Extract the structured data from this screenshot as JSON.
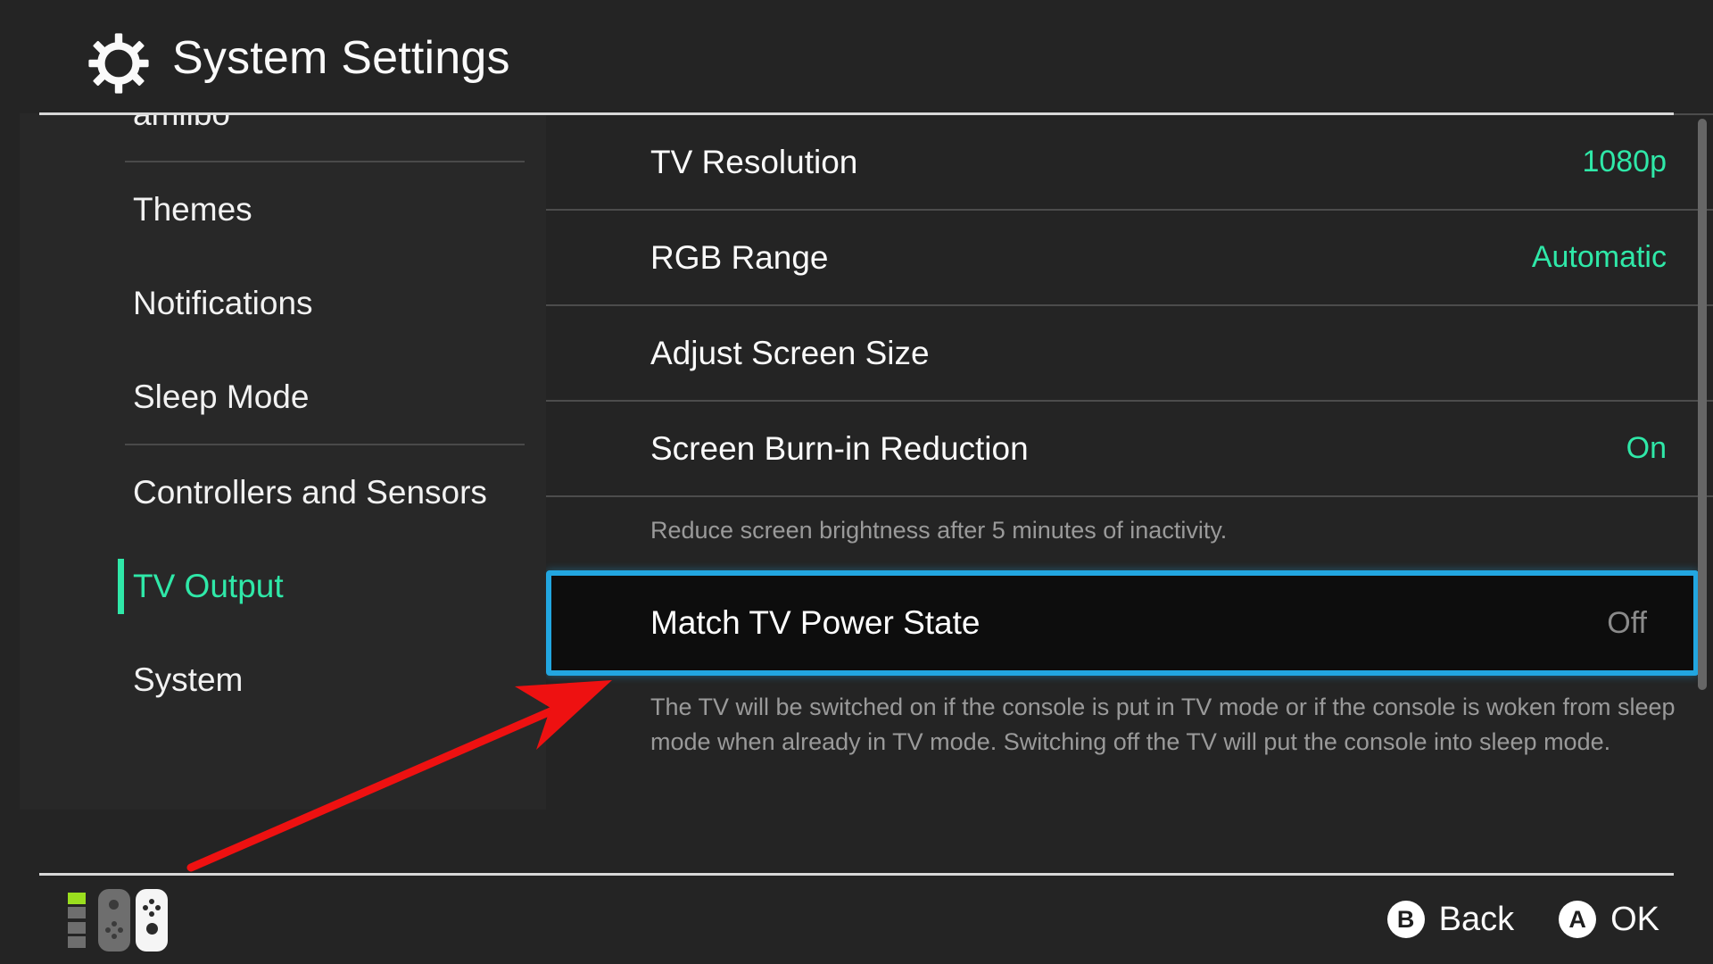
{
  "header": {
    "title": "System Settings",
    "icon": "gear-icon"
  },
  "sidebar": {
    "clipped_top_item": "amiibo",
    "items": [
      {
        "label": "Themes",
        "selected": false
      },
      {
        "label": "Notifications",
        "selected": false
      },
      {
        "label": "Sleep Mode",
        "selected": false
      },
      {
        "label": "Controllers and Sensors",
        "selected": false
      },
      {
        "label": "TV Output",
        "selected": true
      },
      {
        "label": "System",
        "selected": false
      }
    ]
  },
  "panel": {
    "rows": [
      {
        "label": "TV Resolution",
        "value": "1080p",
        "value_state": "accent"
      },
      {
        "label": "RGB Range",
        "value": "Automatic",
        "value_state": "accent"
      },
      {
        "label": "Adjust Screen Size",
        "value": "",
        "value_state": "none"
      },
      {
        "label": "Screen Burn-in Reduction",
        "value": "On",
        "value_state": "accent"
      }
    ],
    "burn_in_note": "Reduce screen brightness after 5 minutes of inactivity.",
    "focused_row": {
      "label": "Match TV Power State",
      "value": "Off"
    },
    "focused_note": "The TV will be switched on if the console is put in TV mode or if the console is woken from sleep mode when already in TV mode. Switching off the TV will put the console into sleep mode."
  },
  "footer": {
    "back": {
      "glyph": "B",
      "label": "Back"
    },
    "ok": {
      "glyph": "A",
      "label": "OK"
    }
  },
  "colors": {
    "background": "#242424",
    "sidebar_background": "#282828",
    "accent_teal": "#2fe8a8",
    "focus_blue": "#22a6e0",
    "focus_fill": "#0d0d0d",
    "muted_text": "#9a9a9a",
    "divider": "#4c4c4c",
    "rule": "#d8d8d8",
    "battery_full": "#9ade1e",
    "annotation_red": "#ee1111"
  },
  "annotation": {
    "type": "arrow",
    "color": "#ee1111",
    "points_at": "Match TV Power State"
  }
}
